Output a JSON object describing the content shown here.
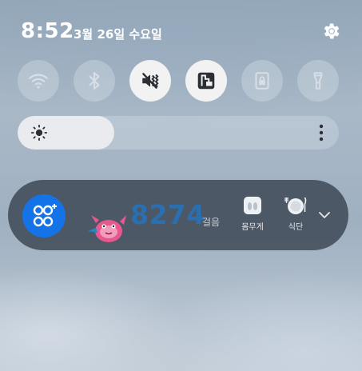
{
  "status": {
    "time": "8:52",
    "date": "3월 26일 수요일"
  },
  "quick_toggles": [
    {
      "name": "wifi",
      "icon": "wifi-icon",
      "state": "off"
    },
    {
      "name": "bluetooth",
      "icon": "bluetooth-icon",
      "state": "off"
    },
    {
      "name": "sound",
      "icon": "mute-vibrate-icon",
      "state": "on"
    },
    {
      "name": "nfc",
      "icon": "nfc-icon",
      "state": "on"
    },
    {
      "name": "screen-lock",
      "icon": "lock-icon",
      "state": "off"
    },
    {
      "name": "flashlight",
      "icon": "flashlight-icon",
      "state": "off"
    }
  ],
  "brightness": {
    "level": 0.3
  },
  "health_widget": {
    "steps": "8274",
    "steps_unit": "걸음",
    "shortcuts": [
      {
        "label": "몸무게",
        "icon": "scale-icon"
      },
      {
        "label": "식단",
        "icon": "meal-icon"
      }
    ]
  },
  "colors": {
    "toggle_on": "#f2f2f2",
    "toggle_off": "rgba(220,228,236,0.35)",
    "health_blue": "#1473e6",
    "steps_blue": "#2a6fb0",
    "widget_bg": "#3a4452"
  }
}
